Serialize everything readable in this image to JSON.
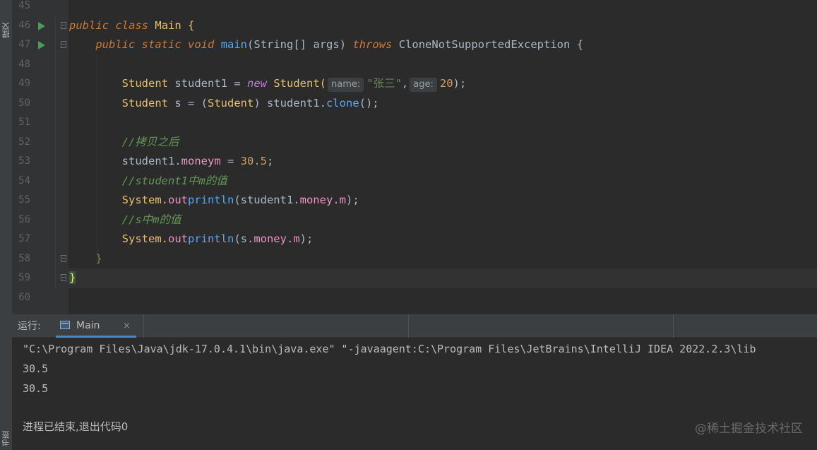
{
  "sidebar": {
    "commit_label": "提交",
    "bookmarks_label": "书签"
  },
  "editor": {
    "line_numbers": [
      "45",
      "46",
      "47",
      "48",
      "49",
      "50",
      "51",
      "52",
      "53",
      "54",
      "55",
      "56",
      "57",
      "58",
      "59",
      "60"
    ],
    "code": {
      "l46": {
        "kw1": "public",
        "kw2": "class",
        "name": "Main",
        "brace": "{"
      },
      "l47": {
        "kw1": "public",
        "kw2": "static",
        "kw3": "void",
        "method": "main",
        "params_open": "(",
        "type": "String[]",
        "param": "args",
        ")": ")",
        "throws": "throws",
        "exception": "CloneNotSupportedException",
        "brace": "{"
      },
      "l49": {
        "type": "Student",
        "var": "student1",
        "eq": " = ",
        "new": "new",
        "ctor": "Student(",
        "hint1": "name:",
        "str": "\"张三\"",
        "comma": ",",
        "hint2": "age:",
        "num": "20",
        "end": ");"
      },
      "l50": {
        "type": "Student",
        "var": " s = (",
        "cast": "Student",
        ") ": ") student1.",
        "method": "clone",
        "end": "();"
      },
      "l52": {
        "comment": "//拷贝之后"
      },
      "l53": {
        "obj": "student1.",
        "field": "money",
        ".": ".",
        "field2": "m",
        "assign": " = ",
        "num": "30.5",
        "end": ";"
      },
      "l54": {
        "comment": "//student1中m的值"
      },
      "l55": {
        "sys": "System.",
        "out": "out",
        ".": ".",
        "println": "println",
        "args_open": "(student1.",
        "field": "money",
        "dot": ".",
        "field2": "m",
        "end": ");"
      },
      "l56": {
        "comment": "//s中m的值"
      },
      "l57": {
        "sys": "System.",
        "out": "out",
        ".": ".",
        "println": "println",
        "args_open": "(s.",
        "field": "money",
        "dot": ".",
        "field2": "m",
        "end": ");"
      },
      "l58": {
        "brace": "}"
      },
      "l59": {
        "brace": "}"
      }
    }
  },
  "run_panel": {
    "title": "运行:",
    "tab_label": "Main",
    "tab_close": "×",
    "console_lines": [
      "\"C:\\Program Files\\Java\\jdk-17.0.4.1\\bin\\java.exe\" \"-javaagent:C:\\Program Files\\JetBrains\\IntelliJ IDEA 2022.2.3\\lib",
      "30.5",
      "30.5",
      "",
      "进程已结束,退出代码0"
    ]
  },
  "watermark": "@稀土掘金技术社区",
  "colors": {
    "background": "#2b2b2b",
    "gutter": "#313335",
    "keyword": "#cc7832",
    "field": "#c77dbb",
    "string": "#6a8759",
    "comment": "#629755",
    "run_icon": "#499c54",
    "tab_underline": "#4a88c7"
  }
}
